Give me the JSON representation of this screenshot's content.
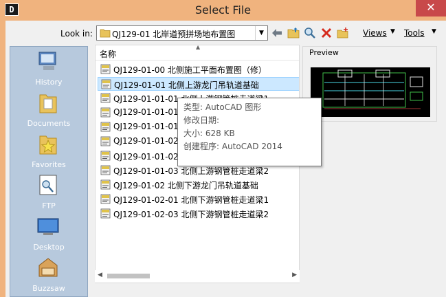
{
  "window": {
    "app_icon_letter": "D",
    "title": "Select File",
    "close_glyph": "✕"
  },
  "toolbar": {
    "lookin_label": "Look in:",
    "lookin_value": "QJ129-01 北岸道预拼场地布置图",
    "views_label": "Views",
    "tools_label": "Tools",
    "icons": [
      "back-arrow-icon",
      "up-folder-icon",
      "search-web-icon",
      "delete-icon",
      "new-folder-icon"
    ]
  },
  "places": [
    {
      "label": "History",
      "icon": "history-icon"
    },
    {
      "label": "Documents",
      "icon": "documents-folder-icon"
    },
    {
      "label": "Favorites",
      "icon": "favorites-folder-icon"
    },
    {
      "label": "FTP",
      "icon": "ftp-icon"
    },
    {
      "label": "Desktop",
      "icon": "desktop-icon"
    },
    {
      "label": "Buzzsaw",
      "icon": "buzzsaw-icon"
    }
  ],
  "filelist": {
    "column_name": "名称",
    "rows": [
      {
        "name": "QJ129-01-00 北侧施工平面布置图（修）",
        "selected": false
      },
      {
        "name": "QJ129-01-01 北侧上游龙门吊轨道基础",
        "selected": true
      },
      {
        "name": "QJ129-01-01-01 北侧上游钢管桩走道梁1",
        "selected": false
      },
      {
        "name": "QJ129-01-01-01",
        "selected": false
      },
      {
        "name": "QJ129-01-01-01",
        "selected": false
      },
      {
        "name": "QJ129-01-01-02",
        "selected": false
      },
      {
        "name": "QJ129-01-01-02-01 垫梁",
        "selected": false
      },
      {
        "name": "QJ129-01-01-03 北侧上游钢管桩走道梁2",
        "selected": false
      },
      {
        "name": "QJ129-01-02 北侧下游龙门吊轨道基础",
        "selected": false
      },
      {
        "name": "QJ129-01-02-01 北侧下游钢管桩走道梁1",
        "selected": false
      },
      {
        "name": "QJ129-01-02-03 北侧下游钢管桩走道梁2",
        "selected": false
      }
    ]
  },
  "preview": {
    "label": "Preview"
  },
  "tooltip": {
    "type_line": "类型: AutoCAD 图形",
    "modified_line": "修改日期:",
    "size_line": "大小: 628 KB",
    "program_line": "创建程序: AutoCAD 2014"
  },
  "colors": {
    "title_bg": "#f0b37e",
    "close_bg": "#c8494a",
    "places_bg": "#b7c9dd",
    "selection_bg": "#cce8ff"
  }
}
